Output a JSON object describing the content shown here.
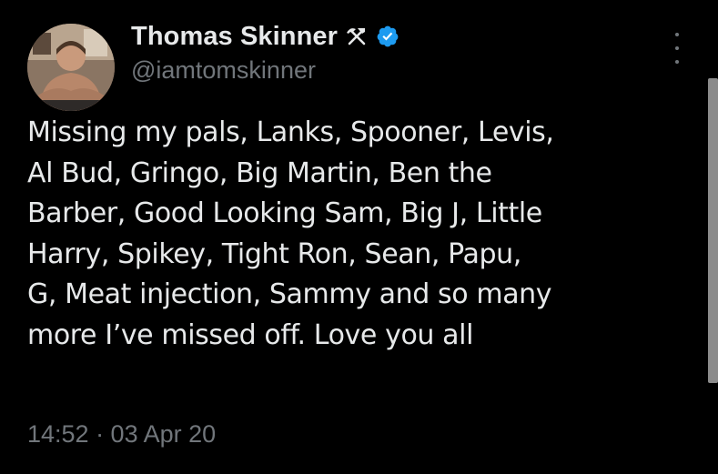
{
  "author": {
    "display_name": "Thomas Skinner",
    "handle": "@iamtomskinner",
    "name_emoji_icon": "hammer-and-pick-icon",
    "verified_icon": "verified-badge-icon",
    "verified_color": "#1d9bf0"
  },
  "tweet": {
    "lines": [
      "Missing my pals, Lanks, Spooner, Levis,",
      "Al Bud, Gringo, Big Martin, Ben the",
      "Barber, Good Looking Sam, Big J, Little",
      "Harry, Spikey, Tight Ron, Sean, Papu,",
      "G, Meat injection, Sammy and so many",
      "more I’ve missed off. Love you all"
    ]
  },
  "meta": {
    "timestamp": "14:52 · 03 Apr 20"
  },
  "colors": {
    "background": "#000000",
    "primary_text": "#e7e9ea",
    "secondary_text": "#71767b"
  },
  "icons": {
    "more_options": "more-options-icon"
  }
}
